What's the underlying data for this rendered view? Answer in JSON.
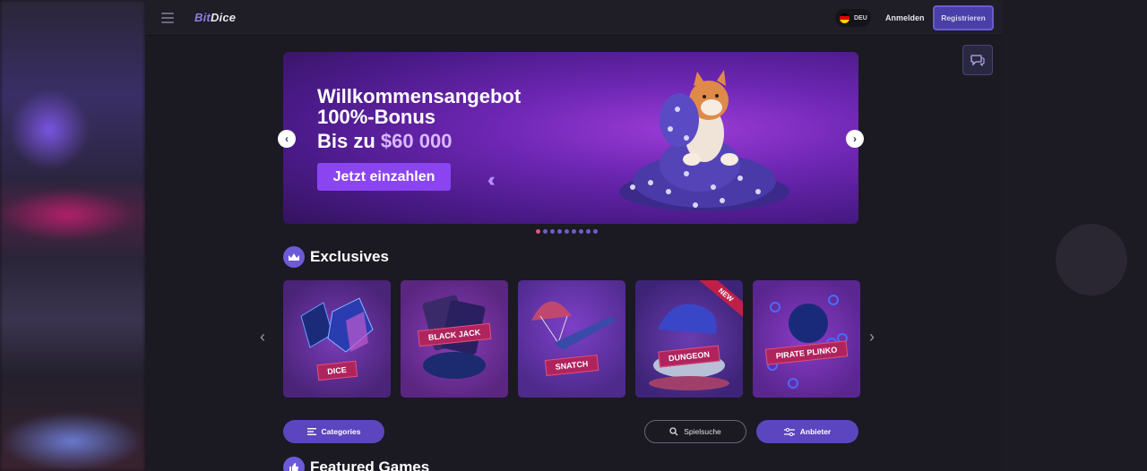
{
  "header": {
    "logo_prefix": "Bit",
    "logo_suffix": "Dice",
    "language": "DEU",
    "login_label": "Anmelden",
    "register_label": "Registrieren"
  },
  "hero": {
    "title_line1": "Willkommensangebot",
    "title_line2": "100%-Bonus",
    "subtitle_prefix": "Bis zu",
    "subtitle_amount": "$60 000",
    "cta_label": "Jetzt einzahlen",
    "slide_count": 9,
    "active_slide": 1
  },
  "exclusives": {
    "title": "Exclusives",
    "games": [
      {
        "label": "DICE",
        "bg": "#5a2a8a"
      },
      {
        "label": "BLACK JACK",
        "bg": "#6a2c8e"
      },
      {
        "label": "SNATCH",
        "bg": "#5b2f96"
      },
      {
        "label": "DUNGEON",
        "bg": "#4a2c8a",
        "badge": "NEW"
      },
      {
        "label": "PIRATE PLINKO",
        "bg": "#6a2896"
      }
    ]
  },
  "filters": {
    "categories_label": "Categories",
    "search_label": "Spielsuche",
    "provider_label": "Anbieter"
  },
  "featured": {
    "title": "Featured Games"
  },
  "colors": {
    "accent": "#5b46bf",
    "background": "#1b1922",
    "register": "#4a3ea8"
  }
}
